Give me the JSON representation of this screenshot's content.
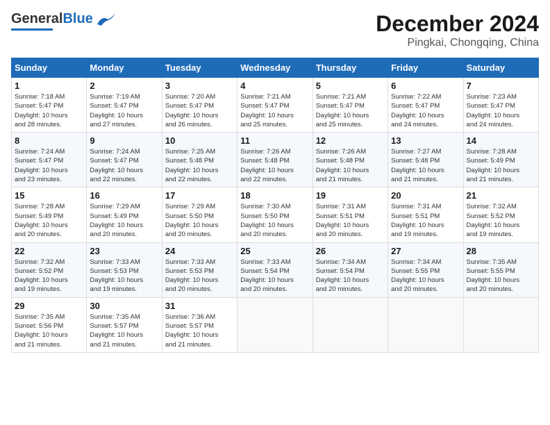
{
  "header": {
    "logo_general": "General",
    "logo_blue": "Blue",
    "title": "December 2024",
    "subtitle": "Pingkai, Chongqing, China"
  },
  "calendar": {
    "days_of_week": [
      "Sunday",
      "Monday",
      "Tuesday",
      "Wednesday",
      "Thursday",
      "Friday",
      "Saturday"
    ],
    "weeks": [
      [
        {
          "day": "1",
          "info": "Sunrise: 7:18 AM\nSunset: 5:47 PM\nDaylight: 10 hours\nand 28 minutes."
        },
        {
          "day": "2",
          "info": "Sunrise: 7:19 AM\nSunset: 5:47 PM\nDaylight: 10 hours\nand 27 minutes."
        },
        {
          "day": "3",
          "info": "Sunrise: 7:20 AM\nSunset: 5:47 PM\nDaylight: 10 hours\nand 26 minutes."
        },
        {
          "day": "4",
          "info": "Sunrise: 7:21 AM\nSunset: 5:47 PM\nDaylight: 10 hours\nand 25 minutes."
        },
        {
          "day": "5",
          "info": "Sunrise: 7:21 AM\nSunset: 5:47 PM\nDaylight: 10 hours\nand 25 minutes."
        },
        {
          "day": "6",
          "info": "Sunrise: 7:22 AM\nSunset: 5:47 PM\nDaylight: 10 hours\nand 24 minutes."
        },
        {
          "day": "7",
          "info": "Sunrise: 7:23 AM\nSunset: 5:47 PM\nDaylight: 10 hours\nand 24 minutes."
        }
      ],
      [
        {
          "day": "8",
          "info": "Sunrise: 7:24 AM\nSunset: 5:47 PM\nDaylight: 10 hours\nand 23 minutes."
        },
        {
          "day": "9",
          "info": "Sunrise: 7:24 AM\nSunset: 5:47 PM\nDaylight: 10 hours\nand 22 minutes."
        },
        {
          "day": "10",
          "info": "Sunrise: 7:25 AM\nSunset: 5:48 PM\nDaylight: 10 hours\nand 22 minutes."
        },
        {
          "day": "11",
          "info": "Sunrise: 7:26 AM\nSunset: 5:48 PM\nDaylight: 10 hours\nand 22 minutes."
        },
        {
          "day": "12",
          "info": "Sunrise: 7:26 AM\nSunset: 5:48 PM\nDaylight: 10 hours\nand 21 minutes."
        },
        {
          "day": "13",
          "info": "Sunrise: 7:27 AM\nSunset: 5:48 PM\nDaylight: 10 hours\nand 21 minutes."
        },
        {
          "day": "14",
          "info": "Sunrise: 7:28 AM\nSunset: 5:49 PM\nDaylight: 10 hours\nand 21 minutes."
        }
      ],
      [
        {
          "day": "15",
          "info": "Sunrise: 7:28 AM\nSunset: 5:49 PM\nDaylight: 10 hours\nand 20 minutes."
        },
        {
          "day": "16",
          "info": "Sunrise: 7:29 AM\nSunset: 5:49 PM\nDaylight: 10 hours\nand 20 minutes."
        },
        {
          "day": "17",
          "info": "Sunrise: 7:29 AM\nSunset: 5:50 PM\nDaylight: 10 hours\nand 20 minutes."
        },
        {
          "day": "18",
          "info": "Sunrise: 7:30 AM\nSunset: 5:50 PM\nDaylight: 10 hours\nand 20 minutes."
        },
        {
          "day": "19",
          "info": "Sunrise: 7:31 AM\nSunset: 5:51 PM\nDaylight: 10 hours\nand 20 minutes."
        },
        {
          "day": "20",
          "info": "Sunrise: 7:31 AM\nSunset: 5:51 PM\nDaylight: 10 hours\nand 19 minutes."
        },
        {
          "day": "21",
          "info": "Sunrise: 7:32 AM\nSunset: 5:52 PM\nDaylight: 10 hours\nand 19 minutes."
        }
      ],
      [
        {
          "day": "22",
          "info": "Sunrise: 7:32 AM\nSunset: 5:52 PM\nDaylight: 10 hours\nand 19 minutes."
        },
        {
          "day": "23",
          "info": "Sunrise: 7:33 AM\nSunset: 5:53 PM\nDaylight: 10 hours\nand 19 minutes."
        },
        {
          "day": "24",
          "info": "Sunrise: 7:33 AM\nSunset: 5:53 PM\nDaylight: 10 hours\nand 20 minutes."
        },
        {
          "day": "25",
          "info": "Sunrise: 7:33 AM\nSunset: 5:54 PM\nDaylight: 10 hours\nand 20 minutes."
        },
        {
          "day": "26",
          "info": "Sunrise: 7:34 AM\nSunset: 5:54 PM\nDaylight: 10 hours\nand 20 minutes."
        },
        {
          "day": "27",
          "info": "Sunrise: 7:34 AM\nSunset: 5:55 PM\nDaylight: 10 hours\nand 20 minutes."
        },
        {
          "day": "28",
          "info": "Sunrise: 7:35 AM\nSunset: 5:55 PM\nDaylight: 10 hours\nand 20 minutes."
        }
      ],
      [
        {
          "day": "29",
          "info": "Sunrise: 7:35 AM\nSunset: 5:56 PM\nDaylight: 10 hours\nand 21 minutes."
        },
        {
          "day": "30",
          "info": "Sunrise: 7:35 AM\nSunset: 5:57 PM\nDaylight: 10 hours\nand 21 minutes."
        },
        {
          "day": "31",
          "info": "Sunrise: 7:36 AM\nSunset: 5:57 PM\nDaylight: 10 hours\nand 21 minutes."
        },
        {
          "day": "",
          "info": ""
        },
        {
          "day": "",
          "info": ""
        },
        {
          "day": "",
          "info": ""
        },
        {
          "day": "",
          "info": ""
        }
      ]
    ]
  }
}
